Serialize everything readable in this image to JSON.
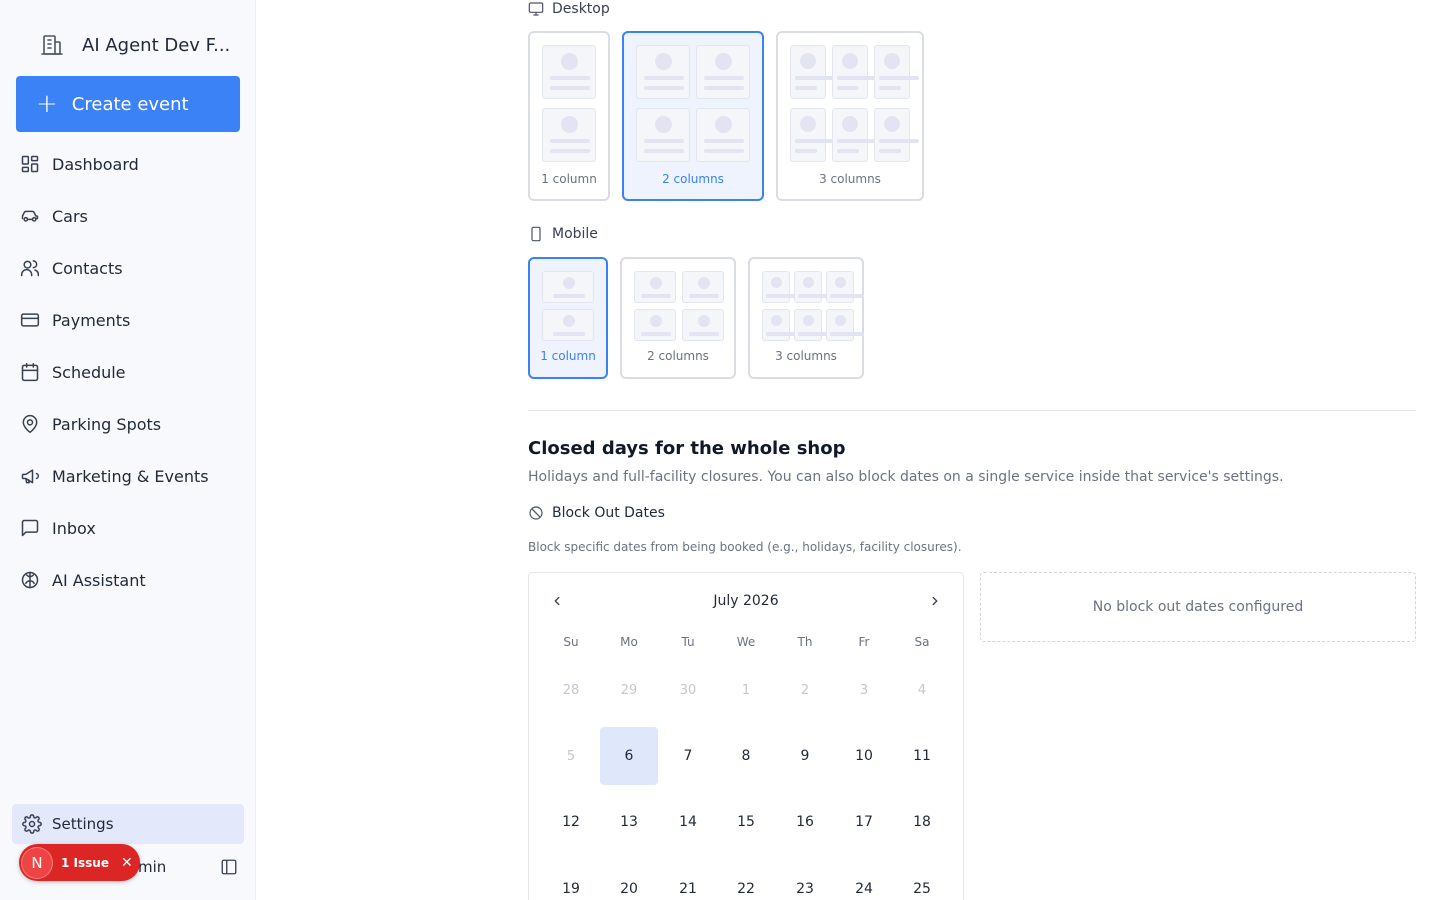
{
  "sidebar": {
    "org_name": "AI Agent Dev F...",
    "create_label": "Create event",
    "items": [
      {
        "label": "Dashboard",
        "icon": "dashboard-icon"
      },
      {
        "label": "Cars",
        "icon": "car-icon"
      },
      {
        "label": "Contacts",
        "icon": "users-icon"
      },
      {
        "label": "Payments",
        "icon": "credit-card-icon"
      },
      {
        "label": "Schedule",
        "icon": "calendar-icon"
      },
      {
        "label": "Parking Spots",
        "icon": "map-pin-icon"
      },
      {
        "label": "Marketing & Events",
        "icon": "megaphone-icon"
      },
      {
        "label": "Inbox",
        "icon": "message-square-icon"
      },
      {
        "label": "AI Assistant",
        "icon": "brain-icon"
      }
    ],
    "settings_label": "Settings",
    "user_name_partial": "min",
    "issue": {
      "avatar_letter": "N",
      "label": "1 Issue"
    }
  },
  "layout": {
    "desktop_label": "Desktop",
    "desktop_options": [
      "1 column",
      "2 columns",
      "3 columns"
    ],
    "desktop_selected": "2 columns",
    "mobile_label": "Mobile",
    "mobile_options": [
      "1 column",
      "2 columns",
      "3 columns"
    ],
    "mobile_selected": "1 column"
  },
  "closed_days": {
    "title": "Closed days for the whole shop",
    "description": "Holidays and full-facility closures. You can also block dates on a single service inside that service's settings.",
    "block_label": "Block Out Dates",
    "block_description": "Block specific dates from being booked (e.g., holidays, facility closures).",
    "empty_message": "No block out dates configured"
  },
  "calendar": {
    "month_label": "July 2026",
    "weekdays": [
      "Su",
      "Mo",
      "Tu",
      "We",
      "Th",
      "Fr",
      "Sa"
    ],
    "weeks": [
      [
        "28",
        "29",
        "30",
        "1",
        "2",
        "3",
        "4"
      ],
      [
        "5",
        "6",
        "7",
        "8",
        "9",
        "10",
        "11"
      ],
      [
        "12",
        "13",
        "14",
        "15",
        "16",
        "17",
        "18"
      ],
      [
        "19",
        "20",
        "21",
        "22",
        "23",
        "24",
        "25"
      ]
    ],
    "muted": [
      "28",
      "29",
      "30",
      "1",
      "2",
      "3",
      "4",
      "5"
    ],
    "today": "6"
  },
  "colors": {
    "accent": "#3b82f6",
    "selected_bg": "#eef3fd",
    "issue_red": "#dc2626"
  }
}
